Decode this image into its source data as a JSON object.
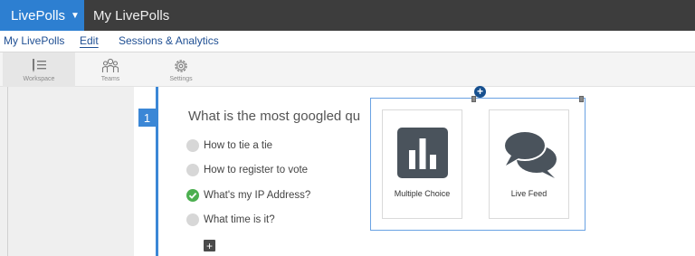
{
  "topbar": {
    "brand": "LivePolls",
    "title": "My LivePolls"
  },
  "subnav": {
    "items": [
      "My LivePolls",
      "Edit",
      "Sessions & Analytics"
    ]
  },
  "toolbar": {
    "items": [
      {
        "label": "Workspace",
        "icon": "workspace-icon"
      },
      {
        "label": "Teams",
        "icon": "teams-icon"
      },
      {
        "label": "Settings",
        "icon": "gear-icon"
      }
    ]
  },
  "question": {
    "number": "1",
    "title": "What is the most googled qu",
    "answers": [
      {
        "text": "How to tie a tie",
        "correct": false
      },
      {
        "text": "How to register to vote",
        "correct": false
      },
      {
        "text": "What's my IP Address?",
        "correct": true
      },
      {
        "text": "What time is it?",
        "correct": false
      }
    ]
  },
  "insert_panel": {
    "options": [
      {
        "label": "Multiple Choice",
        "icon": "bar-chart-icon"
      },
      {
        "label": "Live Feed",
        "icon": "chat-bubbles-icon"
      }
    ]
  },
  "colors": {
    "brand_blue": "#2d7fd1",
    "topbar": "#3d3d3d",
    "nav_link": "#1f4f93",
    "accent": "#3b87d6",
    "correct": "#4caf50"
  }
}
